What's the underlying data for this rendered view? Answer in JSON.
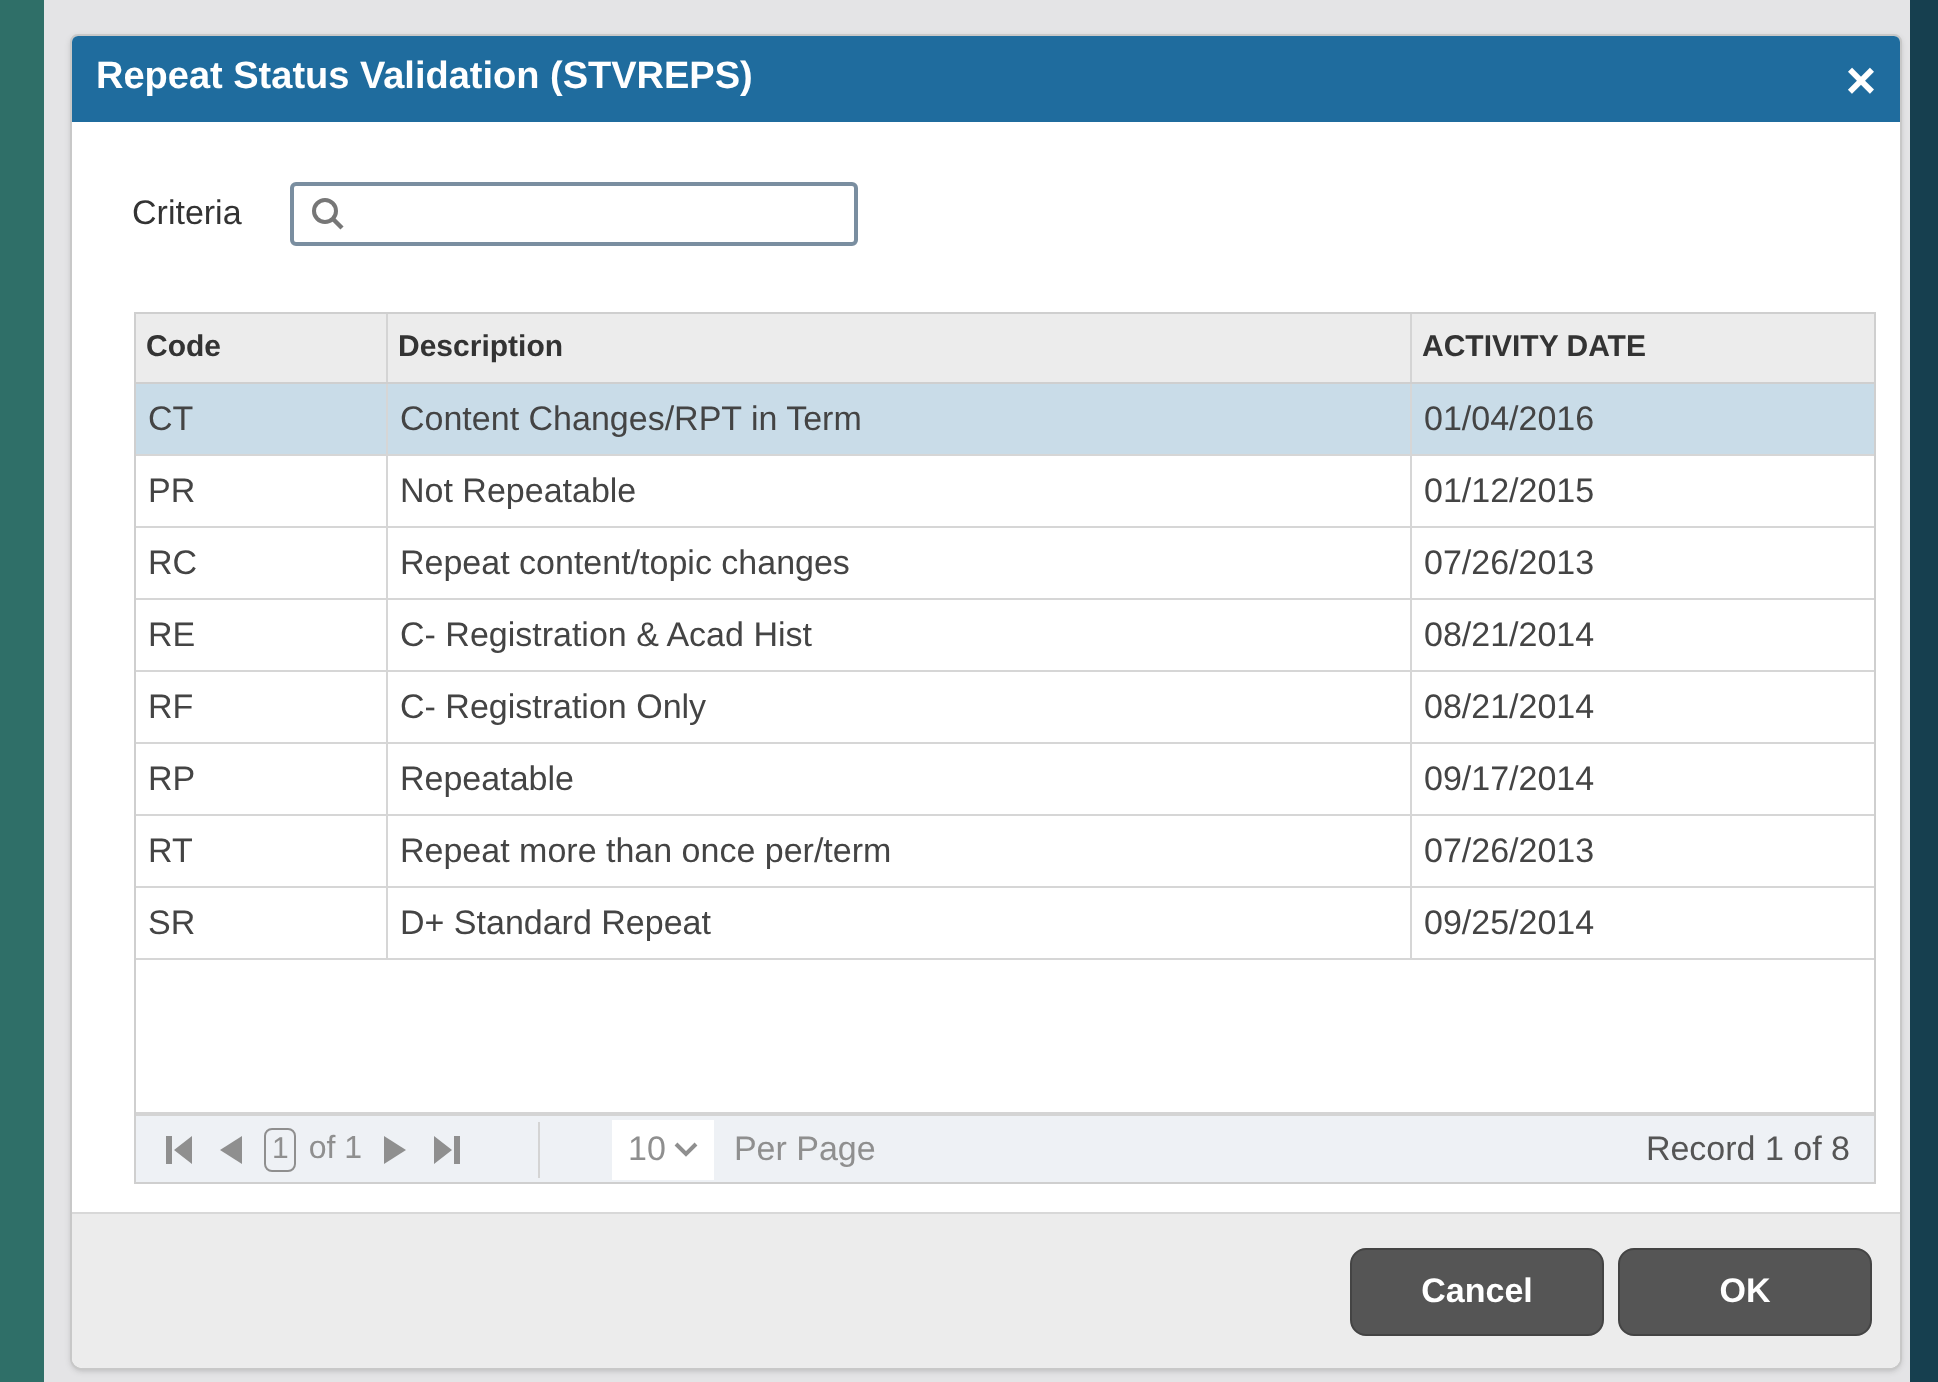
{
  "dialog": {
    "title": "Repeat Status Validation (STVREPS)",
    "close": "×"
  },
  "criteria": {
    "label": "Criteria"
  },
  "table": {
    "columns": [
      "Code",
      "Description",
      "ACTIVITY DATE"
    ],
    "rows": [
      {
        "cells": [
          "CT",
          "Content Changes/RPT in Term",
          "01/04/2016"
        ],
        "selected": true
      },
      {
        "cells": [
          "PR",
          "Not Repeatable",
          "01/12/2015"
        ],
        "selected": false
      },
      {
        "cells": [
          "RC",
          "Repeat content/topic changes",
          "07/26/2013"
        ],
        "selected": false
      },
      {
        "cells": [
          "RE",
          "C- Registration & Acad Hist",
          "08/21/2014"
        ],
        "selected": false
      },
      {
        "cells": [
          "RF",
          "C- Registration Only",
          "08/21/2014"
        ],
        "selected": false
      },
      {
        "cells": [
          "RP",
          "Repeatable",
          "09/17/2014"
        ],
        "selected": false
      },
      {
        "cells": [
          "RT",
          "Repeat more than once per/term",
          "07/26/2013"
        ],
        "selected": false
      },
      {
        "cells": [
          "SR",
          "D+ Standard Repeat",
          "09/25/2014"
        ],
        "selected": false
      }
    ]
  },
  "pager": {
    "page": "1",
    "of": "of 1",
    "per_page": "10",
    "per_page_label": "Per Page",
    "record": "Record 1 of 8",
    "disabled": true
  },
  "buttons": [
    "Cancel",
    "OK"
  ]
}
